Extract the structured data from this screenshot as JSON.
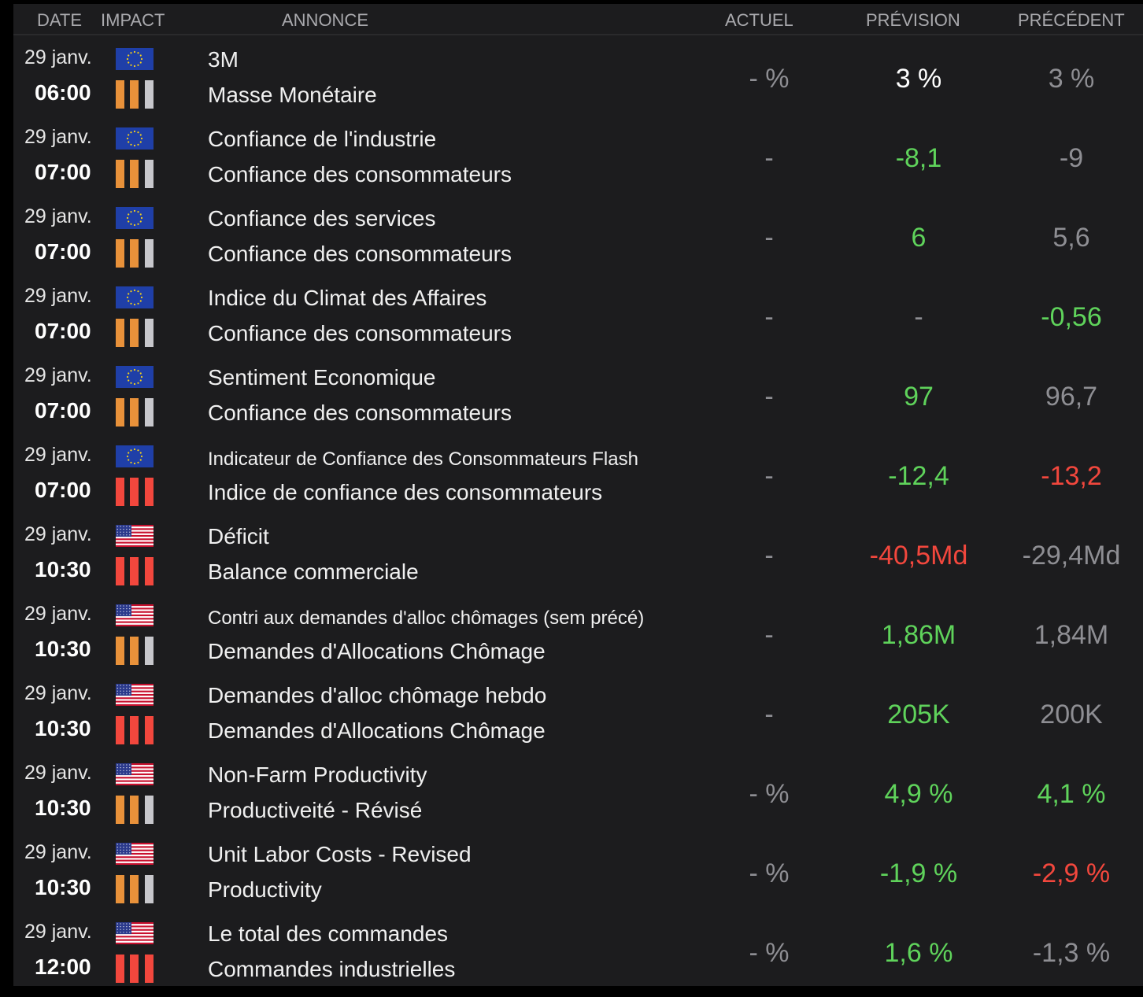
{
  "header": {
    "date": "DATE",
    "impact": "IMPACT",
    "annonce": "ANNONCE",
    "actuel": "ACTUEL",
    "prevision": "PRÉVISION",
    "precedent": "PRÉCÉDENT"
  },
  "colors": {
    "green": "#5fd35b",
    "red": "#f2473d",
    "orange": "#e8913a",
    "gray_bar": "#c7c7cc",
    "gray_text": "#8e8e93",
    "eu_blue": "#1f3fa8"
  },
  "rows": [
    {
      "date": "29 janv.",
      "time": "06:00",
      "flag": "eu-flag-icon",
      "impact": "medium",
      "title1": "3M",
      "title2": "Masse Monétaire",
      "actuel": "- %",
      "prevision": "3 %",
      "prevision_color": "white",
      "precedent": "3 %",
      "precedent_color": "gray"
    },
    {
      "date": "29 janv.",
      "time": "07:00",
      "flag": "eu-flag-icon",
      "impact": "medium",
      "title1": "Confiance de l'industrie",
      "title2": "Confiance des consommateurs",
      "actuel": "-",
      "prevision": "-8,1",
      "prevision_color": "green",
      "precedent": "-9",
      "precedent_color": "gray"
    },
    {
      "date": "29 janv.",
      "time": "07:00",
      "flag": "eu-flag-icon",
      "impact": "medium",
      "title1": "Confiance des services",
      "title2": "Confiance des consommateurs",
      "actuel": "-",
      "prevision": "6",
      "prevision_color": "green",
      "precedent": "5,6",
      "precedent_color": "gray"
    },
    {
      "date": "29 janv.",
      "time": "07:00",
      "flag": "eu-flag-icon",
      "impact": "medium",
      "title1": "Indice du Climat des Affaires",
      "title2": "Confiance des consommateurs",
      "actuel": "-",
      "prevision": "-",
      "prevision_color": "gray",
      "precedent": "-0,56",
      "precedent_color": "green"
    },
    {
      "date": "29 janv.",
      "time": "07:00",
      "flag": "eu-flag-icon",
      "impact": "medium",
      "title1": "Sentiment Economique",
      "title2": "Confiance des consommateurs",
      "actuel": "-",
      "prevision": "97",
      "prevision_color": "green",
      "precedent": "96,7",
      "precedent_color": "gray"
    },
    {
      "date": "29 janv.",
      "time": "07:00",
      "flag": "eu-flag-icon",
      "impact": "high",
      "title1": "Indicateur de Confiance des Consommateurs Flash",
      "title1_small": true,
      "title2": "Indice de confiance des consommateurs",
      "actuel": "-",
      "prevision": "-12,4",
      "prevision_color": "green",
      "precedent": "-13,2",
      "precedent_color": "red"
    },
    {
      "date": "29 janv.",
      "time": "10:30",
      "flag": "us-flag-icon",
      "impact": "high",
      "title1": "Déficit",
      "title2": "Balance commerciale",
      "actuel": "-",
      "prevision": "-40,5Md",
      "prevision_color": "red",
      "precedent": "-29,4Md",
      "precedent_color": "gray"
    },
    {
      "date": "29 janv.",
      "time": "10:30",
      "flag": "us-flag-icon",
      "impact": "medium",
      "title1": "Contri aux demandes d'alloc chômages (sem précé)",
      "title1_small": true,
      "title2": "Demandes d'Allocations Chômage",
      "actuel": "-",
      "prevision": "1,86M",
      "prevision_color": "green",
      "precedent": "1,84M",
      "precedent_color": "gray"
    },
    {
      "date": "29 janv.",
      "time": "10:30",
      "flag": "us-flag-icon",
      "impact": "high",
      "title1": "Demandes d'alloc chômage hebdo",
      "title2": "Demandes d'Allocations Chômage",
      "actuel": "-",
      "prevision": "205K",
      "prevision_color": "green",
      "precedent": "200K",
      "precedent_color": "gray"
    },
    {
      "date": "29 janv.",
      "time": "10:30",
      "flag": "us-flag-icon",
      "impact": "medium",
      "title1": "Non-Farm Productivity",
      "title2": "Productiveité - Révisé",
      "actuel": "- %",
      "prevision": "4,9 %",
      "prevision_color": "green",
      "precedent": "4,1 %",
      "precedent_color": "green"
    },
    {
      "date": "29 janv.",
      "time": "10:30",
      "flag": "us-flag-icon",
      "impact": "medium",
      "title1": "Unit Labor Costs - Revised",
      "title2": "Productivity",
      "actuel": "- %",
      "prevision": "-1,9 %",
      "prevision_color": "green",
      "precedent": "-2,9 %",
      "precedent_color": "red"
    },
    {
      "date": "29 janv.",
      "time": "12:00",
      "flag": "us-flag-icon",
      "impact": "high",
      "title1": "Le total des commandes",
      "title2": "Commandes industrielles",
      "actuel": "- %",
      "prevision": "1,6 %",
      "prevision_color": "green",
      "precedent": "-1,3 %",
      "precedent_color": "gray"
    }
  ]
}
